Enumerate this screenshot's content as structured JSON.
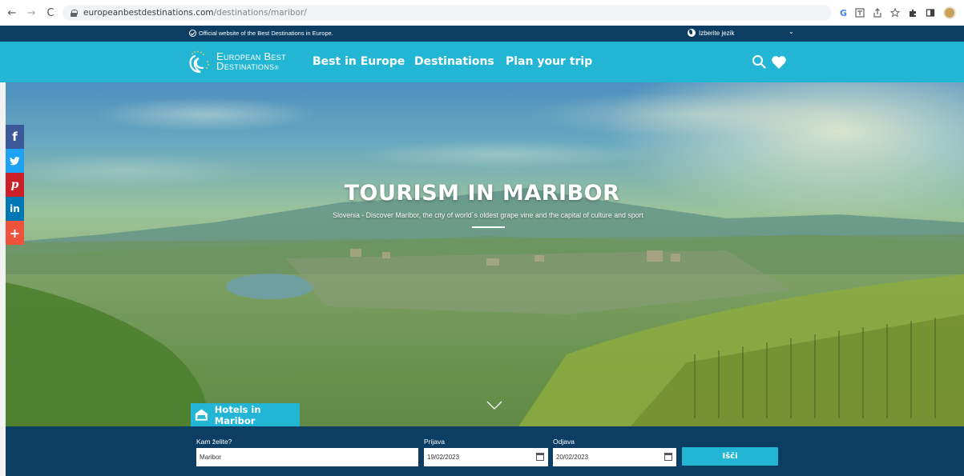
{
  "browser": {
    "back": "←",
    "forward": "→",
    "reload": "C",
    "url_domain": "europeanbestdestinations.com",
    "url_path": "/destinations/maribor/"
  },
  "topstrip": {
    "official": "Official website of the Best Destinations in Europe.",
    "language": "Izberite jezik",
    "language_chevron": "⌄"
  },
  "nav": {
    "logo_line1": "European Best",
    "logo_line2": "Destinations",
    "logo_reg": "®",
    "links": [
      "Best in Europe",
      "Destinations",
      "Plan your trip"
    ]
  },
  "hero": {
    "title": "TOURISM IN MARIBOR",
    "subtitle": "Slovenia - Discover Maribor, the city of world´s oldest grape vine and the capital of culture and sport"
  },
  "social": [
    "f",
    "t",
    "p",
    "in",
    "+"
  ],
  "hotels_tab": "Hotels in Maribor",
  "booking": {
    "where_label": "Kam želite?",
    "where_value": "Maribor",
    "checkin_label": "Prijava",
    "checkin_value": "19/02/2023",
    "checkout_label": "Odjava",
    "checkout_value": "20/02/2023",
    "search_label": "Išči"
  },
  "colors": {
    "brand_cyan": "#22b6d4",
    "brand_navy": "#0c3d62"
  }
}
